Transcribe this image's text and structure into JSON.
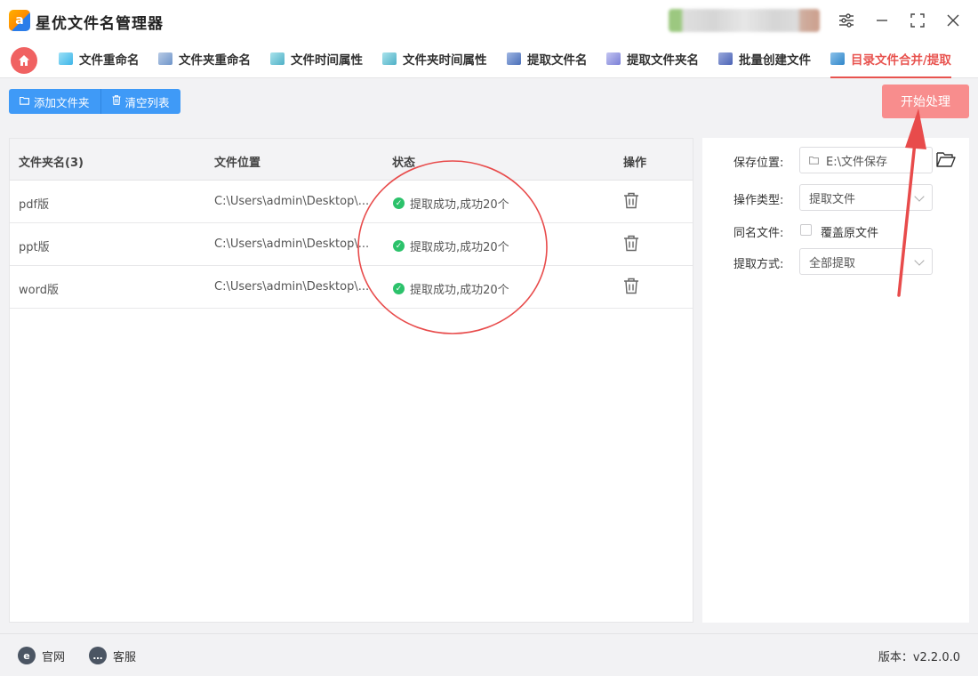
{
  "app": {
    "title": "星优文件名管理器",
    "logo_text": "a"
  },
  "tabs": [
    {
      "label": "文件重命名",
      "icon": "file-rename-icon",
      "color": "#3db5e8"
    },
    {
      "label": "文件夹重命名",
      "icon": "folder-rename-icon",
      "color": "#6f95c9"
    },
    {
      "label": "文件时间属性",
      "icon": "file-time-icon",
      "color": "#4fb0c6"
    },
    {
      "label": "文件夹时间属性",
      "icon": "folder-time-icon",
      "color": "#4fb0c6"
    },
    {
      "label": "提取文件名",
      "icon": "extract-filename-icon",
      "color": "#4a6fb8"
    },
    {
      "label": "提取文件夹名",
      "icon": "extract-foldername-icon",
      "color": "#7a7fd6"
    },
    {
      "label": "批量创建文件",
      "icon": "batch-create-icon",
      "color": "#4b63b5"
    },
    {
      "label": "目录文件合并/提取",
      "icon": "merge-extract-icon",
      "color": "#2f86c9",
      "active": true
    }
  ],
  "toolbar": {
    "add_folder": "添加文件夹",
    "clear_list": "清空列表",
    "start": "开始处理"
  },
  "table": {
    "headers": [
      "文件夹名(3)",
      "文件位置",
      "状态",
      "操作"
    ],
    "rows": [
      {
        "name": "pdf版",
        "path": "C:\\Users\\admin\\Desktop\\...",
        "status": "提取成功,成功20个"
      },
      {
        "name": "ppt版",
        "path": "C:\\Users\\admin\\Desktop\\...",
        "status": "提取成功,成功20个"
      },
      {
        "name": "word版",
        "path": "C:\\Users\\admin\\Desktop\\...",
        "status": "提取成功,成功20个"
      }
    ]
  },
  "settings": {
    "save_location_label": "保存位置:",
    "save_location_value": "E:\\文件保存",
    "op_type_label": "操作类型:",
    "op_type_value": "提取文件",
    "same_name_label": "同名文件:",
    "overwrite_label": "覆盖原文件",
    "overwrite_checked": false,
    "extract_mode_label": "提取方式:",
    "extract_mode_value": "全部提取"
  },
  "footer": {
    "website": "官网",
    "support": "客服",
    "version": "版本：v2.2.0.0"
  },
  "colors": {
    "accent_red": "#e8534f",
    "primary_blue": "#3f9af7",
    "start_button": "#f88d8d",
    "success_green": "#2cc26b",
    "annotation_red": "#e84b4b"
  }
}
